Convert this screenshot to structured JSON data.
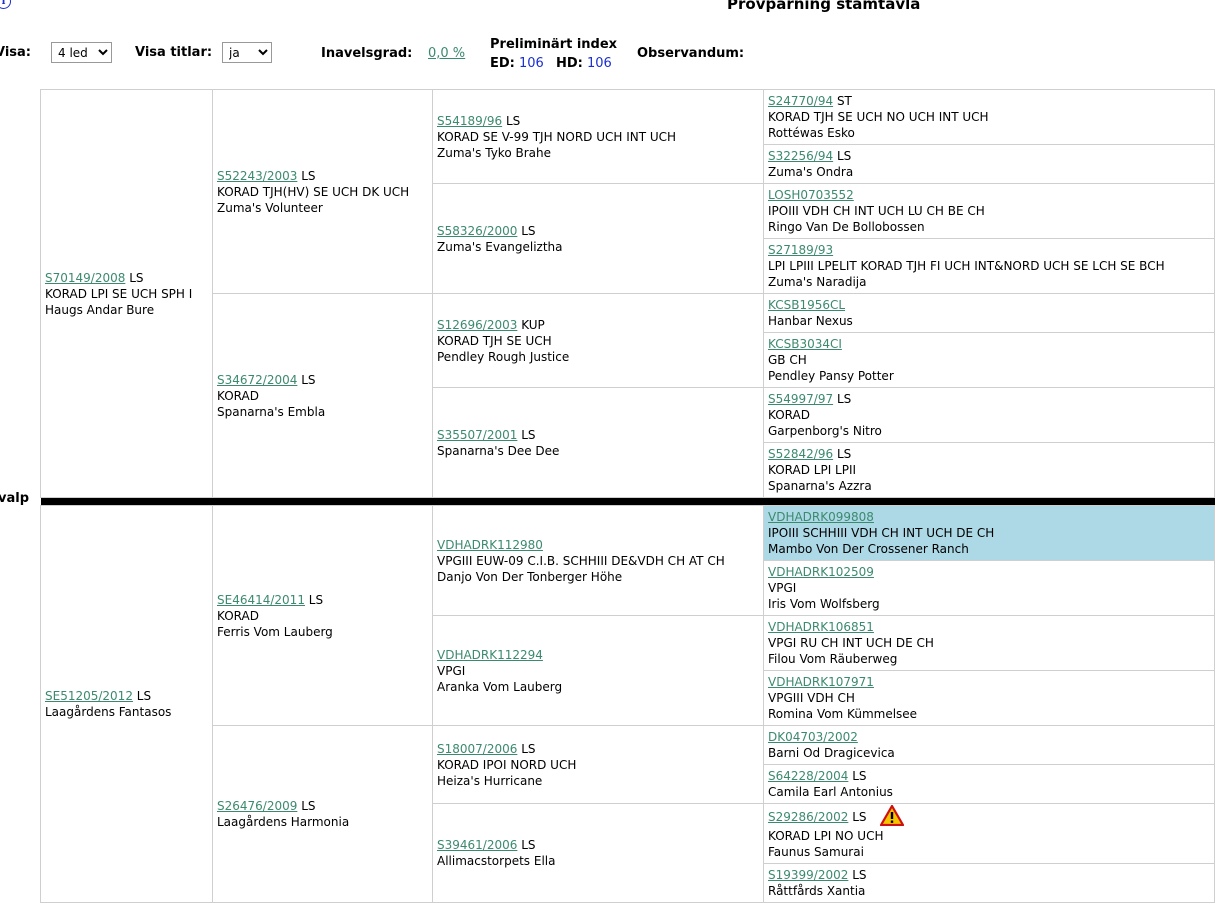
{
  "header": {
    "title": "Provparning stamtavla",
    "visa_label": "Visa:",
    "visa_value": "4 led",
    "visa_titlar_label": "Visa titlar:",
    "visa_titlar_value": "ja",
    "inavelsgrad_label": "Inavelsgrad:",
    "inavelsgrad_value": "0,0 %",
    "index_label": "Preliminärt index",
    "ed_label": "ED:",
    "ed_value": "106",
    "hd_label": "HD:",
    "hd_value": "106",
    "observandum_label": "Observandum:"
  },
  "side_label": "valp",
  "pedigree": {
    "sire": {
      "reg": "S70149/2008",
      "suffix": "LS",
      "titles": "KORAD LPI SE UCH SPH I",
      "name": "Haugs Andar Bure"
    },
    "sire_sire": {
      "reg": "S52243/2003",
      "suffix": "LS",
      "titles": "KORAD TJH(HV) SE UCH DK UCH",
      "name": "Zuma's Volunteer"
    },
    "sire_dam": {
      "reg": "S34672/2004",
      "suffix": "LS",
      "titles": "KORAD",
      "name": "Spanarna's Embla"
    },
    "ss_sire": {
      "reg": "S54189/96",
      "suffix": "LS",
      "titles": "KORAD SE V-99 TJH NORD UCH INT UCH",
      "name": "Zuma's Tyko Brahe"
    },
    "ss_dam": {
      "reg": "S58326/2000",
      "suffix": "LS",
      "titles": "",
      "name": "Zuma's Evangeliztha"
    },
    "sd_sire": {
      "reg": "S12696/2003",
      "suffix": "KUP",
      "titles": "KORAD TJH SE UCH",
      "name": "Pendley Rough Justice"
    },
    "sd_dam": {
      "reg": "S35507/2001",
      "suffix": "LS",
      "titles": "",
      "name": "Spanarna's Dee Dee"
    },
    "g4_top": [
      {
        "reg": "S24770/94",
        "suffix": "ST",
        "titles": "KORAD TJH SE UCH NO UCH INT UCH",
        "name": "Rottéwas Esko"
      },
      {
        "reg": "S32256/94",
        "suffix": "LS",
        "titles": "",
        "name": "Zuma's Ondra"
      },
      {
        "reg": "LOSH0703552",
        "suffix": "",
        "titles": "IPOIII VDH CH INT UCH LU CH BE CH",
        "name": "Ringo Van De Bollobossen"
      },
      {
        "reg": "S27189/93",
        "suffix": "",
        "titles": "LPI LPIII LPELIT KORAD TJH FI UCH INT&NORD UCH SE LCH SE BCH",
        "name": "Zuma's Naradija"
      },
      {
        "reg": "KCSB1956CL",
        "suffix": "",
        "titles": "",
        "name": "Hanbar Nexus"
      },
      {
        "reg": "KCSB3034CI",
        "suffix": "",
        "titles": "GB CH",
        "name": "Pendley Pansy Potter"
      },
      {
        "reg": "S54997/97",
        "suffix": "LS",
        "titles": "KORAD",
        "name": "Garpenborg's Nitro"
      },
      {
        "reg": "S52842/96",
        "suffix": "LS",
        "titles": "KORAD LPI LPII",
        "name": "Spanarna's Azzra"
      }
    ],
    "dam": {
      "reg": "SE51205/2012",
      "suffix": "LS",
      "titles": "",
      "name": "Laagårdens Fantasos"
    },
    "dam_sire": {
      "reg": "SE46414/2011",
      "suffix": "LS",
      "titles": "KORAD",
      "name": "Ferris Vom Lauberg"
    },
    "dam_dam": {
      "reg": "S26476/2009",
      "suffix": "LS",
      "titles": "",
      "name": "Laagårdens Harmonia"
    },
    "ds_sire": {
      "reg": "VDHADRK112980",
      "suffix": "",
      "titles": "VPGIII EUW-09 C.I.B. SCHHIII DE&VDH CH AT CH",
      "name": "Danjo Von Der Tonberger Höhe"
    },
    "ds_dam": {
      "reg": "VDHADRK112294",
      "suffix": "",
      "titles": "VPGI",
      "name": "Aranka Vom Lauberg"
    },
    "dd_sire": {
      "reg": "S18007/2006",
      "suffix": "LS",
      "titles": "KORAD IPOI NORD UCH",
      "name": "Heiza's Hurricane"
    },
    "dd_dam": {
      "reg": "S39461/2006",
      "suffix": "LS",
      "titles": "",
      "name": "Allimacstorpets Ella"
    },
    "g4_bottom": [
      {
        "reg": "VDHADRK099808",
        "suffix": "",
        "titles": "IPOIII SCHHIII VDH CH INT UCH DE CH",
        "name": "Mambo Von Der Crossener Ranch"
      },
      {
        "reg": "VDHADRK102509",
        "suffix": "",
        "titles": "VPGI",
        "name": "Iris Vom Wolfsberg"
      },
      {
        "reg": "VDHADRK106851",
        "suffix": "",
        "titles": "VPGI RU CH INT UCH DE CH",
        "name": "Filou Vom Räuberweg"
      },
      {
        "reg": "VDHADRK107971",
        "suffix": "",
        "titles": "VPGIII VDH CH",
        "name": "Romina Vom Kümmelsee"
      },
      {
        "reg": "DK04703/2002",
        "suffix": "",
        "titles": "",
        "name": "Barni Od Dragicevica"
      },
      {
        "reg": "S64228/2004",
        "suffix": "LS",
        "titles": "",
        "name": "Camila Earl Antonius"
      },
      {
        "reg": "S29286/2002",
        "suffix": "LS",
        "titles": "KORAD LPI NO UCH",
        "name": "Faunus Samurai"
      },
      {
        "reg": "S19399/2002",
        "suffix": "LS",
        "titles": "",
        "name": "Råttfårds Xantia"
      }
    ]
  },
  "colors": {
    "link": "#3c8a6e",
    "highlight": "#add8e6",
    "index_value": "#1a2fd0",
    "warning": "#f5c400"
  },
  "icons": {
    "info": "info-icon",
    "warning": "warning-icon"
  }
}
